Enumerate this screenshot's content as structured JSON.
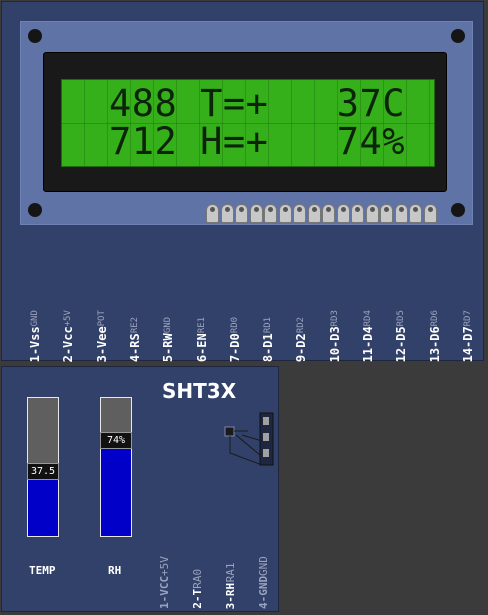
{
  "lcd": {
    "line1": "488 T=+   37C",
    "line2": "712 H=+   74%",
    "pins": [
      {
        "label": "1-Vss",
        "sub": "GND"
      },
      {
        "label": "2-Vcc",
        "sub": "+5V"
      },
      {
        "label": "3-Vee",
        "sub": "POT"
      },
      {
        "label": "4-RS",
        "sub": "RE2"
      },
      {
        "label": "5-RW",
        "sub": "GND"
      },
      {
        "label": "6-EN",
        "sub": "RE1"
      },
      {
        "label": "7-D0",
        "sub": "RD0"
      },
      {
        "label": "8-D1",
        "sub": "RD1"
      },
      {
        "label": "9-D2",
        "sub": "RD2"
      },
      {
        "label": "10-D3",
        "sub": "RD3"
      },
      {
        "label": "11-D4",
        "sub": "RD4"
      },
      {
        "label": "12-D5",
        "sub": "RD5"
      },
      {
        "label": "13-D6",
        "sub": "RD6"
      },
      {
        "label": "14-D7",
        "sub": "RD7"
      }
    ]
  },
  "sht3x": {
    "title": "SHT3X",
    "temp": {
      "label": "TEMP",
      "value_text": "37.5",
      "fill_fraction": 0.41
    },
    "rh": {
      "label": "RH",
      "value_text": "74%",
      "fill_fraction": 0.64
    },
    "pins": [
      {
        "label": "1-VCC",
        "sub": "+5V",
        "dim": true
      },
      {
        "label": "2-T",
        "sub": "RA0",
        "dim": false
      },
      {
        "label": "3-RH",
        "sub": "RA1",
        "dim": false
      },
      {
        "label": "4-GND",
        "sub": "GND",
        "dim": true
      }
    ]
  },
  "colors": {
    "lcd_glass": "#35b01a",
    "lcd_text": "#0c240a",
    "board": "#324169",
    "bar_fill": "#0000c8"
  }
}
